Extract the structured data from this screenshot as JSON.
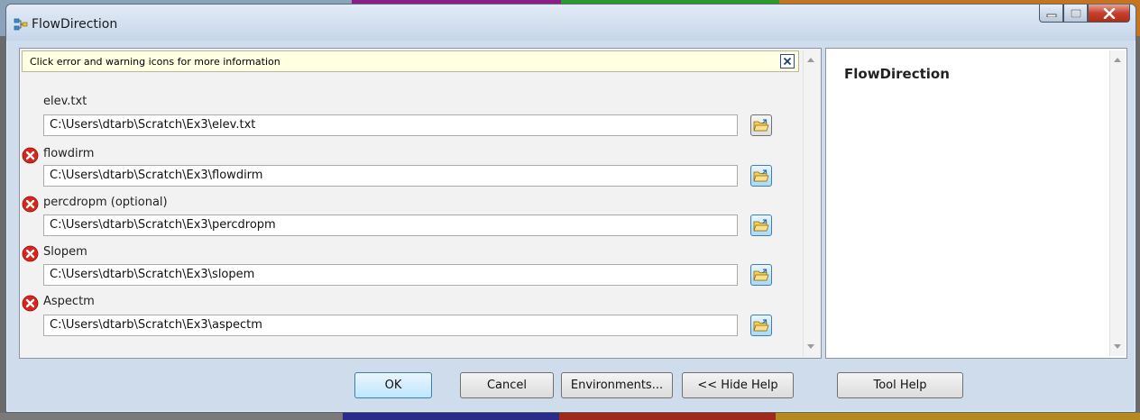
{
  "window": {
    "title": "FlowDirection",
    "icon": "tool-model-icon"
  },
  "message_bar": {
    "text": "Click error and warning icons for more information",
    "close_icon": "close-x-icon"
  },
  "params": [
    {
      "label": "elev.txt",
      "value": "C:\\Users\\dtarb\\Scratch\\Ex3\\elev.txt",
      "error": false
    },
    {
      "label": "flowdirm",
      "value": "C:\\Users\\dtarb\\Scratch\\Ex3\\flowdirm",
      "error": true
    },
    {
      "label": "percdropm (optional)",
      "value": "C:\\Users\\dtarb\\Scratch\\Ex3\\percdropm",
      "error": true
    },
    {
      "label": "Slopem",
      "value": "C:\\Users\\dtarb\\Scratch\\Ex3\\slopem",
      "error": true
    },
    {
      "label": "Aspectm",
      "value": "C:\\Users\\dtarb\\Scratch\\Ex3\\aspectm",
      "error": true
    }
  ],
  "help": {
    "title": "FlowDirection"
  },
  "buttons": {
    "ok": "OK",
    "cancel": "Cancel",
    "environments": "Environments...",
    "hide_help": "<< Hide Help",
    "tool_help": "Tool Help"
  },
  "colors": {
    "error_red": "#d9241c",
    "message_bg": "#ffffe1",
    "default_button": "#bee6fd"
  }
}
